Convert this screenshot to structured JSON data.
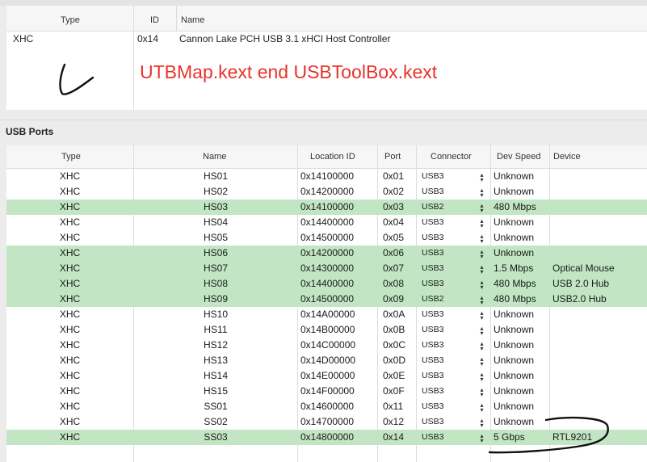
{
  "controllers": {
    "headers": {
      "type": "Type",
      "id": "ID",
      "name": "Name"
    },
    "row": {
      "type": "XHC",
      "id": "0x14",
      "name": "Cannon Lake PCH USB 3.1 xHCI Host Controller"
    }
  },
  "annotation": {
    "text": "UTBMap.kext end USBToolBox.kext",
    "color": "#e8322c"
  },
  "ports_section": {
    "label": "USB Ports",
    "headers": {
      "type": "Type",
      "name": "Name",
      "location": "Location ID",
      "port": "Port",
      "connector": "Connector",
      "speed": "Dev Speed",
      "device": "Device"
    },
    "highlight_color": "#c2e6c4",
    "rows": [
      {
        "type": "XHC",
        "name": "HS01",
        "location": "0x14100000",
        "port": "0x01",
        "connector": "USB3",
        "speed": "Unknown",
        "device": "",
        "highlighted": false
      },
      {
        "type": "XHC",
        "name": "HS02",
        "location": "0x14200000",
        "port": "0x02",
        "connector": "USB3",
        "speed": "Unknown",
        "device": "",
        "highlighted": false
      },
      {
        "type": "XHC",
        "name": "HS03",
        "location": "0x14100000",
        "port": "0x03",
        "connector": "USB2",
        "speed": "480 Mbps",
        "device": "",
        "highlighted": true
      },
      {
        "type": "XHC",
        "name": "HS04",
        "location": "0x14400000",
        "port": "0x04",
        "connector": "USB3",
        "speed": "Unknown",
        "device": "",
        "highlighted": false
      },
      {
        "type": "XHC",
        "name": "HS05",
        "location": "0x14500000",
        "port": "0x05",
        "connector": "USB3",
        "speed": "Unknown",
        "device": "",
        "highlighted": false
      },
      {
        "type": "XHC",
        "name": "HS06",
        "location": "0x14200000",
        "port": "0x06",
        "connector": "USB3",
        "speed": "Unknown",
        "device": "",
        "highlighted": true
      },
      {
        "type": "XHC",
        "name": "HS07",
        "location": "0x14300000",
        "port": "0x07",
        "connector": "USB3",
        "speed": "1.5 Mbps",
        "device": "Optical Mouse",
        "highlighted": true
      },
      {
        "type": "XHC",
        "name": "HS08",
        "location": "0x14400000",
        "port": "0x08",
        "connector": "USB3",
        "speed": "480 Mbps",
        "device": "USB 2.0 Hub",
        "highlighted": true
      },
      {
        "type": "XHC",
        "name": "HS09",
        "location": "0x14500000",
        "port": "0x09",
        "connector": "USB2",
        "speed": "480 Mbps",
        "device": "USB2.0 Hub",
        "highlighted": true
      },
      {
        "type": "XHC",
        "name": "HS10",
        "location": "0x14A00000",
        "port": "0x0A",
        "connector": "USB3",
        "speed": "Unknown",
        "device": "",
        "highlighted": false
      },
      {
        "type": "XHC",
        "name": "HS11",
        "location": "0x14B00000",
        "port": "0x0B",
        "connector": "USB3",
        "speed": "Unknown",
        "device": "",
        "highlighted": false
      },
      {
        "type": "XHC",
        "name": "HS12",
        "location": "0x14C00000",
        "port": "0x0C",
        "connector": "USB3",
        "speed": "Unknown",
        "device": "",
        "highlighted": false
      },
      {
        "type": "XHC",
        "name": "HS13",
        "location": "0x14D00000",
        "port": "0x0D",
        "connector": "USB3",
        "speed": "Unknown",
        "device": "",
        "highlighted": false
      },
      {
        "type": "XHC",
        "name": "HS14",
        "location": "0x14E00000",
        "port": "0x0E",
        "connector": "USB3",
        "speed": "Unknown",
        "device": "",
        "highlighted": false
      },
      {
        "type": "XHC",
        "name": "HS15",
        "location": "0x14F00000",
        "port": "0x0F",
        "connector": "USB3",
        "speed": "Unknown",
        "device": "",
        "highlighted": false
      },
      {
        "type": "XHC",
        "name": "SS01",
        "location": "0x14600000",
        "port": "0x11",
        "connector": "USB3",
        "speed": "Unknown",
        "device": "",
        "highlighted": false
      },
      {
        "type": "XHC",
        "name": "SS02",
        "location": "0x14700000",
        "port": "0x12",
        "connector": "USB3",
        "speed": "Unknown",
        "device": "",
        "highlighted": false
      },
      {
        "type": "XHC",
        "name": "SS03",
        "location": "0x14800000",
        "port": "0x14",
        "connector": "USB3",
        "speed": "5 Gbps",
        "device": "RTL9201",
        "highlighted": true
      }
    ]
  },
  "icons": {
    "connector_popup": "up-down-chevron-icon"
  }
}
